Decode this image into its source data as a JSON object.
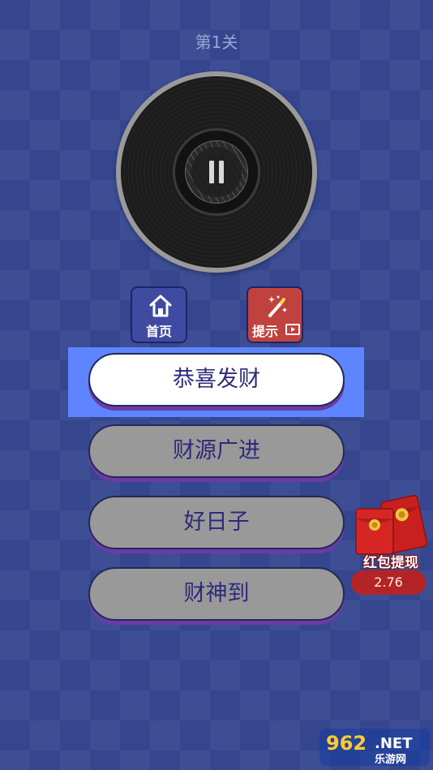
{
  "level": {
    "title": "第1关"
  },
  "buttons": {
    "home_label": "首页",
    "hint_label": "提示"
  },
  "options": [
    {
      "label": "恭喜发财",
      "selected": true
    },
    {
      "label": "财源广进",
      "selected": false
    },
    {
      "label": "好日子",
      "selected": false
    },
    {
      "label": "财神到",
      "selected": false
    }
  ],
  "redpacket": {
    "label": "红包提现",
    "amount": "2.76"
  },
  "watermark": {
    "number": "962",
    "suffix": ".NET",
    "subtitle": "乐游网"
  },
  "colors": {
    "background": "#35468f",
    "highlight": "#5e85ff",
    "option_selected": "#ffffff",
    "option_normal": "#999999",
    "option_text": "#2e2a7a",
    "hint_button": "#c0423e",
    "home_button": "#3f4aa0"
  },
  "icons": {
    "home": "home-icon",
    "hint": "magic-wand-icon",
    "video": "video-icon",
    "pause": "pause-icon"
  }
}
